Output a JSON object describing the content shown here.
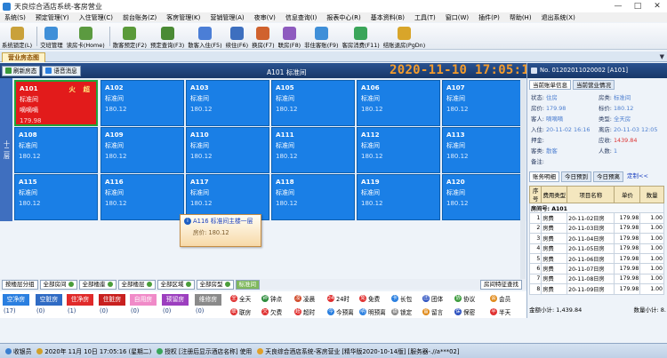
{
  "window": {
    "title": "天良综合酒店系统-客房营业",
    "min": "—",
    "max": "□",
    "close": "✕"
  },
  "menu": [
    "系统(S)",
    "预定管理(Y)",
    "入住管理(C)",
    "前台账务(Z)",
    "客房管理(K)",
    "营销管理(A)",
    "夜审(V)",
    "信息查询(I)",
    "报表中心(R)",
    "基本资料(B)",
    "工具(T)",
    "窗口(W)",
    "插件(P)",
    "帮助(H)",
    "退出系统(X)"
  ],
  "toolbar": [
    {
      "label": "系统锁定(L)",
      "icon": "lock-icon",
      "color": "#c9a13a"
    },
    {
      "label": "交班管理",
      "icon": "shift-icon",
      "color": "#3f8fd8"
    },
    {
      "label": "读房卡(Home)",
      "icon": "card-icon",
      "color": "#5b9a40"
    },
    {
      "label": "散客预定(F2)",
      "icon": "book-icon",
      "color": "#5a9a3a"
    },
    {
      "label": "预定查询(F3)",
      "icon": "query-icon",
      "color": "#4a8a35"
    },
    {
      "label": "散客入住(F5)",
      "icon": "checkin-icon",
      "color": "#4b7ed6"
    },
    {
      "label": "续住(F6)",
      "icon": "extend-icon",
      "color": "#3d6fbf"
    },
    {
      "label": "换房(F7)",
      "icon": "change-room-icon",
      "color": "#d0622e"
    },
    {
      "label": "联房(F8)",
      "icon": "link-room-icon",
      "color": "#8e5bbf"
    },
    {
      "label": "非住客账(F9)",
      "icon": "nonguest-icon",
      "color": "#3f8fd8"
    },
    {
      "label": "客房消费(F11)",
      "icon": "consume-icon",
      "color": "#3aa55a"
    },
    {
      "label": "结账退房(PgDn)",
      "icon": "checkout-icon",
      "color": "#d8a52a"
    }
  ],
  "tab": {
    "label": "营业房态图"
  },
  "topstrip": {
    "refresh_label": "刷新房态",
    "voice_label": "语音消息",
    "room_title": "A101  标准间",
    "clock": "2020-11-10  17:05:17"
  },
  "floor": {
    "label": "十二层"
  },
  "rooms": [
    {
      "no": "A101",
      "type": "标准间",
      "guest": "嘀嘀嘀",
      "price": "179.98",
      "flag": "火 超",
      "status": "occupied"
    },
    {
      "no": "A102",
      "type": "标准间",
      "guest": "",
      "price": "180.12",
      "flag": "",
      "status": "vacant"
    },
    {
      "no": "A103",
      "type": "标准间",
      "guest": "",
      "price": "180.12",
      "flag": "",
      "status": "vacant"
    },
    {
      "no": "A105",
      "type": "标准间",
      "guest": "",
      "price": "180.12",
      "flag": "",
      "status": "vacant"
    },
    {
      "no": "A106",
      "type": "标准间",
      "guest": "",
      "price": "180.12",
      "flag": "",
      "status": "vacant"
    },
    {
      "no": "A107",
      "type": "标准间",
      "guest": "",
      "price": "180.12",
      "flag": "",
      "status": "vacant"
    },
    {
      "no": "A108",
      "type": "标准间",
      "guest": "",
      "price": "180.12",
      "flag": "",
      "status": "vacant"
    },
    {
      "no": "A109",
      "type": "标准间",
      "guest": "",
      "price": "180.12",
      "flag": "",
      "status": "vacant"
    },
    {
      "no": "A110",
      "type": "标准间",
      "guest": "",
      "price": "180.12",
      "flag": "",
      "status": "vacant"
    },
    {
      "no": "A111",
      "type": "标准间",
      "guest": "",
      "price": "180.12",
      "flag": "",
      "status": "vacant"
    },
    {
      "no": "A112",
      "type": "标准间",
      "guest": "",
      "price": "180.12",
      "flag": "",
      "status": "vacant"
    },
    {
      "no": "A113",
      "type": "标准间",
      "guest": "",
      "price": "180.12",
      "flag": "",
      "status": "vacant"
    },
    {
      "no": "A115",
      "type": "标准间",
      "guest": "",
      "price": "180.12",
      "flag": "",
      "status": "vacant"
    },
    {
      "no": "A116",
      "type": "标准间",
      "guest": "",
      "price": "180.12",
      "flag": "",
      "status": "vacant"
    },
    {
      "no": "A117",
      "type": "标准间",
      "guest": "",
      "price": "180.12",
      "flag": "",
      "status": "vacant"
    },
    {
      "no": "A118",
      "type": "标准间",
      "guest": "",
      "price": "180.12",
      "flag": "",
      "status": "vacant"
    },
    {
      "no": "A119",
      "type": "标准间",
      "guest": "",
      "price": "180.12",
      "flag": "",
      "status": "vacant"
    },
    {
      "no": "A120",
      "type": "标准间",
      "guest": "",
      "price": "180.12",
      "flag": "",
      "status": "vacant"
    }
  ],
  "tooltip": {
    "title": "A116 标准间主楼一层",
    "price": "房价: 180.12"
  },
  "filters": [
    {
      "label": "按楼层分组",
      "active": false
    },
    {
      "label": "全部房间",
      "active": false
    },
    {
      "label": "全部楼座",
      "active": false
    },
    {
      "label": "全部楼层",
      "active": false
    },
    {
      "label": "全部区域",
      "active": false
    },
    {
      "label": "全部房型",
      "active": false
    },
    {
      "label": "标准间",
      "active": true
    }
  ],
  "filter_right": "房间特征查找",
  "status_buttons": [
    {
      "label": "空净房",
      "count": "(17)",
      "color": "#2a7fe0"
    },
    {
      "label": "空脏房",
      "count": "(0)",
      "color": "#2f6bc4"
    },
    {
      "label": "住净房",
      "count": "(1)",
      "color": "#e02a2a"
    },
    {
      "label": "住脏房",
      "count": "(0)",
      "color": "#c8201f"
    },
    {
      "label": "自用房",
      "count": "(0)",
      "color": "#f08ac8"
    },
    {
      "label": "预留房",
      "count": "(0)",
      "color": "#9c3fbf"
    },
    {
      "label": "维修房",
      "count": "(0)",
      "color": "#8a8a8a"
    }
  ],
  "legend_row1": [
    {
      "sym": "全",
      "label": "全天",
      "color": "#e03030"
    },
    {
      "sym": "钟",
      "label": "钟点",
      "color": "#2a8a3a"
    },
    {
      "sym": "凌",
      "label": "凌晨",
      "color": "#d04a2a"
    },
    {
      "sym": "24",
      "label": "24时",
      "color": "#e03030"
    },
    {
      "sym": "免",
      "label": "免费",
      "color": "#e03030"
    },
    {
      "sym": "卡",
      "label": "长包",
      "color": "#2a7fe0"
    },
    {
      "sym": "团",
      "label": "团体",
      "color": "#2a4fbf"
    },
    {
      "sym": "协",
      "label": "协议",
      "color": "#3a9a3a"
    },
    {
      "sym": "会",
      "label": "会员",
      "color": "#e08a1a"
    }
  ],
  "legend_row2": [
    {
      "sym": "联",
      "label": "联房",
      "color": "#e03030"
    },
    {
      "sym": "欠",
      "label": "欠费",
      "color": "#e03030"
    },
    {
      "sym": "超",
      "label": "超时",
      "color": "#e03030"
    },
    {
      "sym": "今",
      "label": "今预离",
      "color": "#2a7fe0"
    },
    {
      "sym": "明",
      "label": "明预离",
      "color": "#2a7fe0"
    },
    {
      "sym": "锁",
      "label": "锁定",
      "color": "#8a8a8a"
    },
    {
      "sym": "留",
      "label": "留言",
      "color": "#e08a1a"
    },
    {
      "sym": "保",
      "label": "保密",
      "color": "#2a4fbf"
    },
    {
      "sym": "半",
      "label": "半天",
      "color": "#e03030"
    }
  ],
  "right": {
    "header": "No. 01202011020002 [A101]",
    "tab1": "当前账单信息",
    "tab2": "当前营业情况",
    "info": {
      "status_k": "状态:",
      "status_v": "住房",
      "price_k": "房价:",
      "price_v": "179.98",
      "guest_k": "客人:",
      "guest_v": "嘀嘀嘀",
      "checkin_k": "入住:",
      "checkin_v": "20-11-02 16:16",
      "deposit_k": "押金:",
      "deposit_v": "",
      "guesttype_k": "客类:",
      "guesttype_v": "散客",
      "remark_k": "备注:",
      "remark_v": "",
      "roomtype_k": "房类:",
      "roomtype_v": "标准间",
      "std_k": "标价:",
      "std_v": "180.12",
      "class_k": "类型:",
      "class_v": "全天房",
      "depart_k": "离店:",
      "depart_v": "20-11-03 12:05",
      "due_k": "应收:",
      "due_v": "1439.84",
      "people_k": "人数:",
      "people_v": "1"
    },
    "tab3": "账务明细",
    "tab4": "今日预到",
    "tab5": "今日预离",
    "customize": "定制<<",
    "cols": [
      "序号",
      "费用类型",
      "项目名称",
      "单价",
      "数量"
    ],
    "room_row": "房间号:   A101",
    "rows": [
      [
        "1",
        "房费",
        "20-11-02日房",
        "179.98",
        "1.00"
      ],
      [
        "2",
        "房费",
        "20-11-03日房",
        "179.98",
        "1.00"
      ],
      [
        "3",
        "房费",
        "20-11-04日房",
        "179.98",
        "1.00"
      ],
      [
        "4",
        "房费",
        "20-11-05日房",
        "179.98",
        "1.00"
      ],
      [
        "5",
        "房费",
        "20-11-06日房",
        "179.98",
        "1.00"
      ],
      [
        "6",
        "房费",
        "20-11-07日房",
        "179.98",
        "1.00"
      ],
      [
        "7",
        "房费",
        "20-11-08日房",
        "179.98",
        "1.00"
      ],
      [
        "8",
        "房费",
        "20-11-09日房",
        "179.98",
        "1.00"
      ]
    ],
    "subtotal_k": "金额小计:",
    "subtotal_v": "1,439.84",
    "qty_k": "数量小计:",
    "qty_v": "8."
  },
  "statusbar": [
    "收银员",
    "2020年 11月 10日 17:05:16 (星期二)",
    "授权 [注册后显示酒店名称] 使用",
    "天良综合酒店系统-客房营业 [精华版2020-10-14版]  [服务器-.//a***02]"
  ]
}
